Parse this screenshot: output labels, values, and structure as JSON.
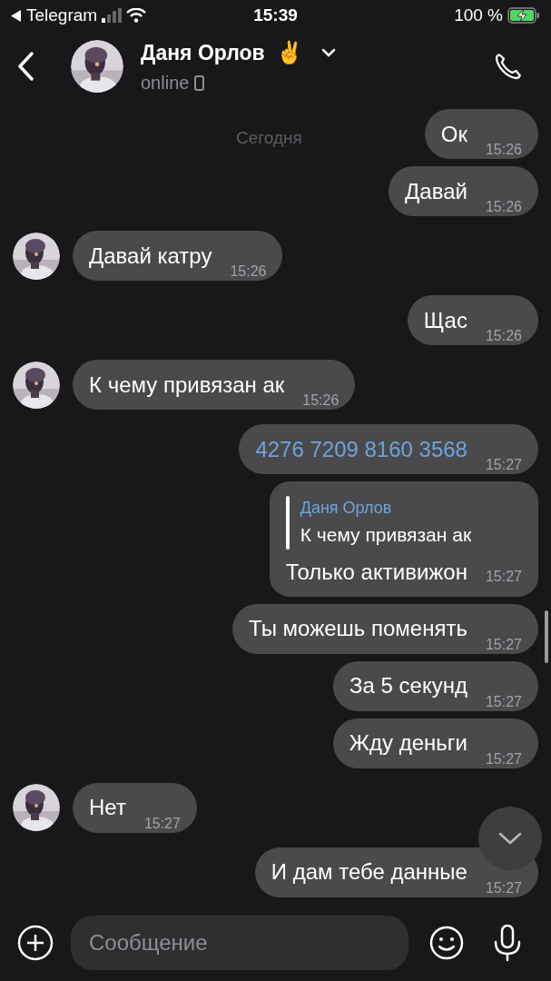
{
  "status_bar": {
    "back_app": "Telegram",
    "time": "15:39",
    "battery": "100 %"
  },
  "header": {
    "name": "Даня Орлов",
    "emoji": "✌️",
    "status": "online"
  },
  "date_label": "Сегодня",
  "messages": [
    {
      "kind": "sent",
      "text": "Ок",
      "time": "15:26"
    },
    {
      "kind": "sent",
      "text": "Давай",
      "time": "15:26"
    },
    {
      "kind": "received",
      "text": "Давай катру",
      "time": "15:26"
    },
    {
      "kind": "sent",
      "text": "Щас",
      "time": "15:26"
    },
    {
      "kind": "received",
      "text": "К чему привязан ак",
      "time": "15:26"
    },
    {
      "kind": "link",
      "text": "4276 7209 8160 3568",
      "time": "15:27"
    },
    {
      "kind": "reply",
      "reply": {
        "author": "Даня Орлов",
        "text": "К чему привязан ак"
      },
      "text": "Только активижон",
      "time": "15:27"
    },
    {
      "kind": "sent",
      "text": "Ты можешь поменять",
      "time": "15:27"
    },
    {
      "kind": "sent",
      "text": "За 5 секунд",
      "time": "15:27"
    },
    {
      "kind": "sent",
      "text": "Жду деньги",
      "time": "15:27"
    },
    {
      "kind": "received",
      "text": "Нет",
      "time": "15:27"
    },
    {
      "kind": "sent",
      "text": "И дам тебе данные",
      "time": "15:27"
    }
  ],
  "composer": {
    "placeholder": "Сообщение"
  }
}
